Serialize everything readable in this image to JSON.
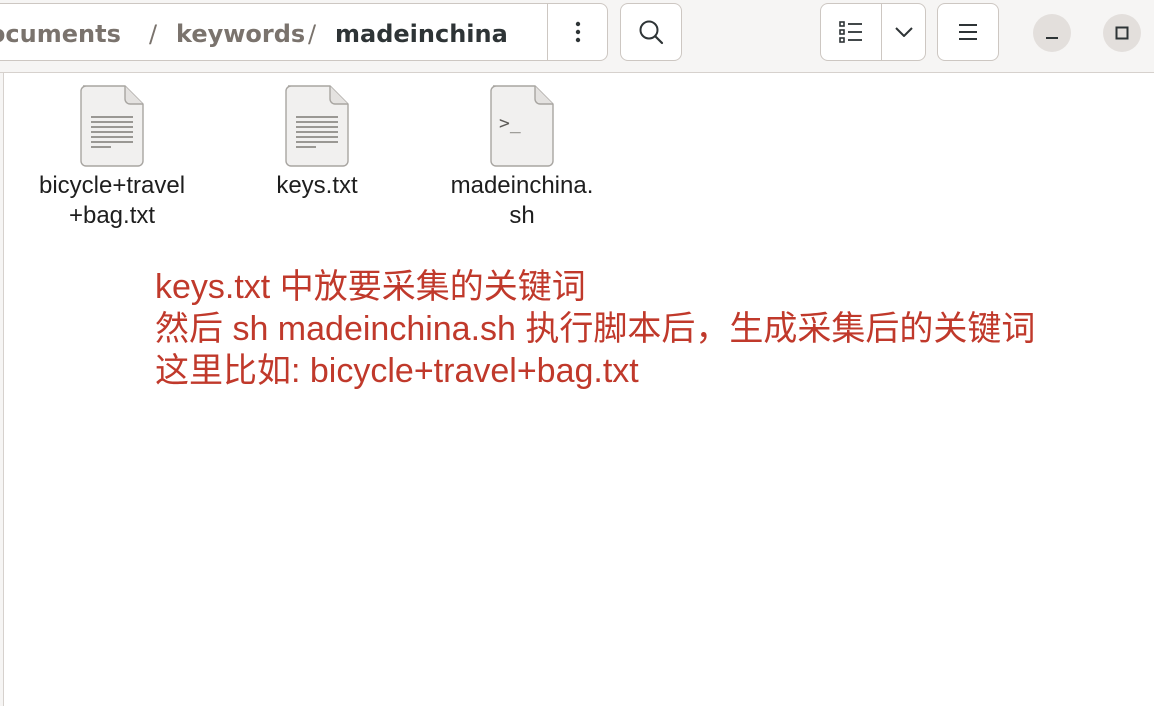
{
  "breadcrumb": {
    "items": [
      "Documents",
      "keywords"
    ],
    "separator": "/",
    "current": "madeinchina"
  },
  "files": [
    {
      "name": "bicycle+travel+bag.txt",
      "icon": "text-file-icon"
    },
    {
      "name": "keys.txt",
      "icon": "text-file-icon"
    },
    {
      "name": "madeinchina.sh",
      "icon": "script-file-icon",
      "glyph": ">_"
    }
  ],
  "annotation": {
    "lines": [
      "keys.txt 中放要采集的关键词",
      "然后 sh madeinchina.sh 执行脚本后，生成采集后的关键词",
      "这里比如: bicycle+travel+bag.txt"
    ],
    "color": "#c0392b"
  },
  "colors": {
    "header_bg": "#f6f5f4",
    "border": "#cdc7c2",
    "text": "#2e3436"
  }
}
